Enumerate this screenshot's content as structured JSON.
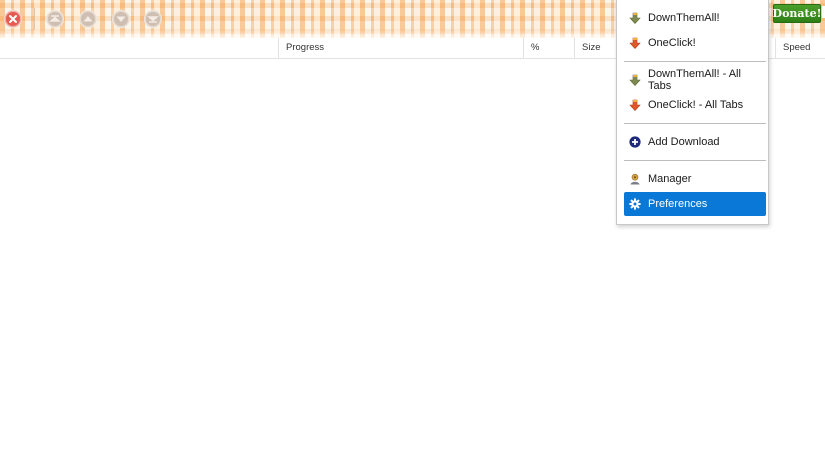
{
  "toolbar": {
    "buttons": [
      {
        "name": "remove-icon",
        "color": "#e23b3b"
      },
      {
        "name": "move-top-icon",
        "color": "#d8c8b8"
      },
      {
        "name": "move-up-icon",
        "color": "#d8c8b8"
      },
      {
        "name": "move-down-icon",
        "color": "#d8c8b8"
      },
      {
        "name": "move-bottom-icon",
        "color": "#d8c8b8"
      }
    ],
    "donate_label": "Donate!",
    "donate_color": "#3a8f1f"
  },
  "columns": {
    "progress": "Progress",
    "percent": "%",
    "size": "Size",
    "speed": "Speed"
  },
  "menu": {
    "items": [
      {
        "label": "DownThemAll!",
        "icon": "downthemall-arrow-icon"
      },
      {
        "label": "OneClick!",
        "icon": "oneclick-arrow-icon"
      },
      {
        "label": "DownThemAll! - All Tabs",
        "icon": "downthemall-arrow-icon"
      },
      {
        "label": "OneClick! - All Tabs",
        "icon": "oneclick-arrow-icon"
      },
      {
        "label": "Add Download",
        "icon": "add-circle-icon"
      },
      {
        "label": "Manager",
        "icon": "manager-icon"
      },
      {
        "label": "Preferences",
        "icon": "gear-icon",
        "active": true
      }
    ],
    "highlight_color": "#0a78d7"
  }
}
